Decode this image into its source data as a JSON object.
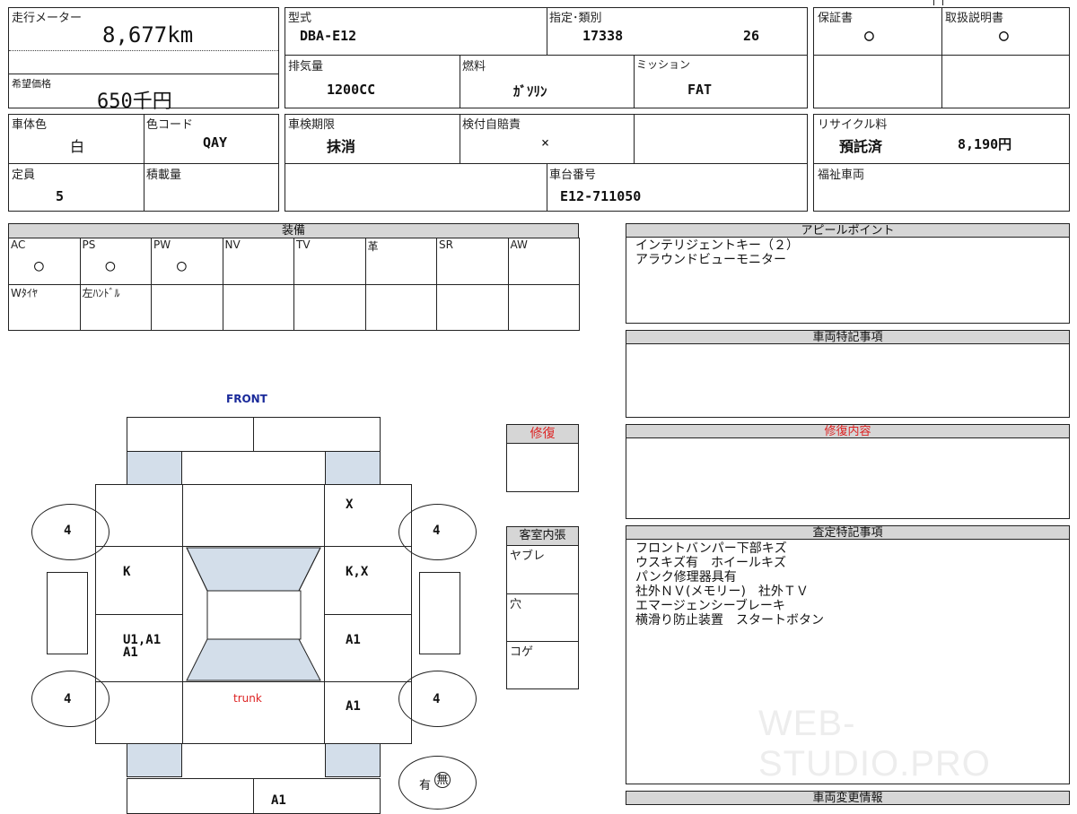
{
  "mileage": {
    "label": "走行メーター",
    "value": "8,677km"
  },
  "price": {
    "label": "希望価格",
    "value": "650千円"
  },
  "model": {
    "label": "型式",
    "value": "DBA-E12"
  },
  "designation": {
    "label": "指定･類別",
    "value1": "17338",
    "value2": "26"
  },
  "displacement": {
    "label": "排気量",
    "value": "1200CC"
  },
  "fuel": {
    "label": "燃料",
    "value": "ｶﾞｿﾘﾝ"
  },
  "mission": {
    "label": "ミッション",
    "value": "FAT"
  },
  "warranty": {
    "label": "保証書",
    "value": "○"
  },
  "manual": {
    "label": "取扱説明書",
    "value": "○"
  },
  "body_color": {
    "label": "車体色",
    "value": "白"
  },
  "color_code": {
    "label": "色コード",
    "value": "QAY"
  },
  "inspection": {
    "label": "車検期限",
    "value": "抹消"
  },
  "insurance": {
    "label": "検付自賠責",
    "value": "×"
  },
  "recycle": {
    "label": "リサイクル料",
    "status": "預託済",
    "amount": "8,190円"
  },
  "capacity": {
    "label": "定員",
    "value": "5"
  },
  "load": {
    "label": "積載量"
  },
  "chassis": {
    "label": "車台番号",
    "value": "E12-711050"
  },
  "welfare": {
    "label": "福祉車両"
  },
  "equipment": {
    "title": "装備",
    "row1": [
      {
        "label": "AC",
        "value": "○"
      },
      {
        "label": "PS",
        "value": "○"
      },
      {
        "label": "PW",
        "value": "○"
      },
      {
        "label": "NV",
        "value": ""
      },
      {
        "label": "TV",
        "value": ""
      },
      {
        "label": "革",
        "value": ""
      },
      {
        "label": "SR",
        "value": ""
      },
      {
        "label": "AW",
        "value": ""
      }
    ],
    "row2": [
      {
        "label": "Wﾀｲﾔ"
      },
      {
        "label": "左ﾊﾝﾄﾞﾙ"
      },
      {
        "label": ""
      },
      {
        "label": ""
      },
      {
        "label": ""
      },
      {
        "label": ""
      },
      {
        "label": ""
      },
      {
        "label": ""
      }
    ]
  },
  "appeal": {
    "title": "アピールポイント",
    "lines": "インテリジェントキー（２）\nアラウンドビューモニター"
  },
  "vehicle_notes": {
    "title": "車両特記事項"
  },
  "repair_details": {
    "title": "修復内容"
  },
  "assessment": {
    "title": "査定特記事項",
    "lines": "フロントバンパー下部キズ\nウスキズ有　ホイールキズ\nパンク修理器具有\n社外ＮＶ(メモリー)　社外ＴＶ\nエマージェンシーブレーキ\n横滑り防止装置　スタートボタン"
  },
  "change_info": {
    "title": "車両変更情報"
  },
  "repair_box": {
    "title": "修復"
  },
  "interior": {
    "title": "客室内張",
    "rows": [
      "ヤブレ",
      "穴",
      "コゲ"
    ]
  },
  "diagram": {
    "front": "FRONT",
    "trunk": "trunk",
    "tire_fl": "4",
    "tire_fr": "4",
    "tire_rl": "4",
    "tire_rr": "4",
    "mark_right_fender": "X",
    "mark_left_front_door": "K",
    "mark_right_front_door": "K,X",
    "mark_left_rear_door_1": "U1,A1",
    "mark_left_rear_door_2": "A1",
    "mark_right_rear_door": "A1",
    "mark_right_quarter": "A1",
    "mark_rear_bumper": "A1",
    "spare_label_have": "有",
    "spare_label_none": "無"
  },
  "watermark": "WEB-STUDIO.PRO"
}
